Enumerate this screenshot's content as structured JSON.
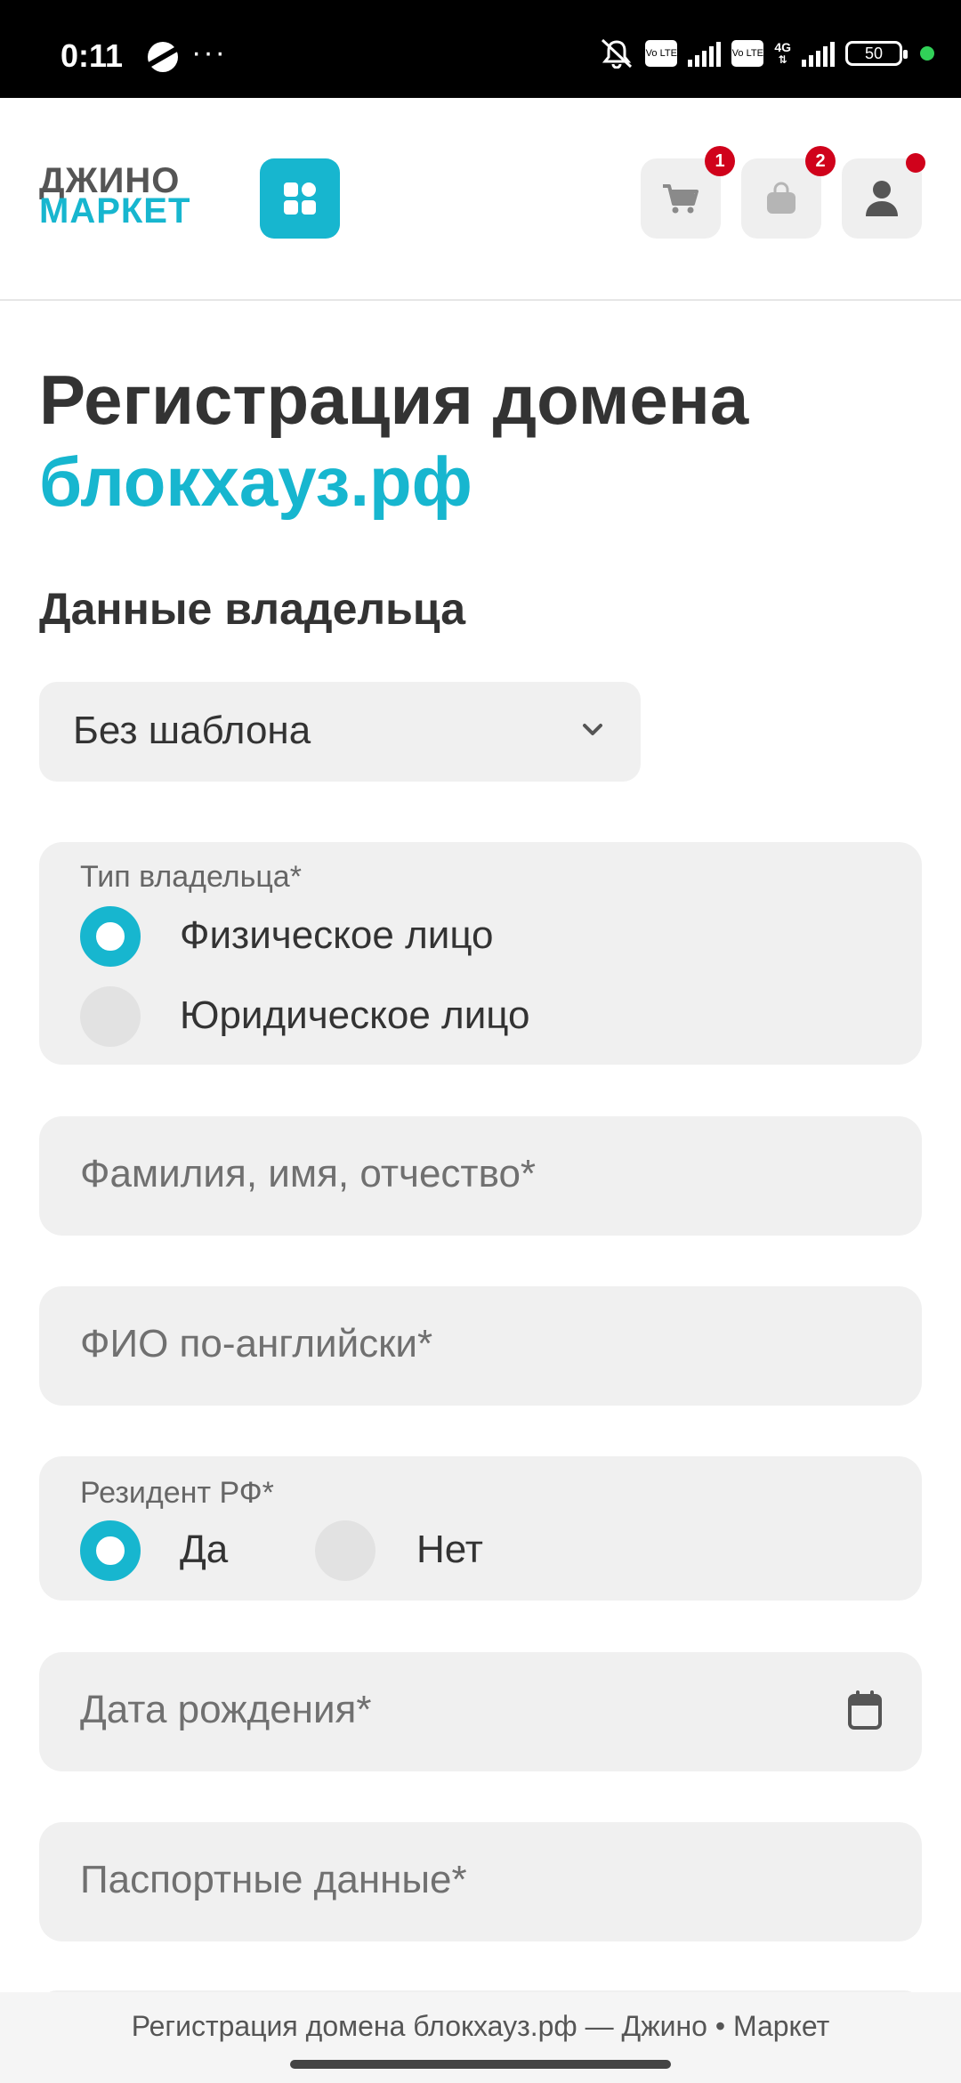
{
  "status_bar": {
    "time": "0:11",
    "dots": "···",
    "lte1": "Vo LTE",
    "lte2": "Vo LTE",
    "net": "4G",
    "battery": "50"
  },
  "header": {
    "logo_line1": "ДЖИНО",
    "logo_line2": "МАРКЕТ",
    "cart_badge": "1",
    "bag_badge": "2",
    "accent_color": "#17b6cf",
    "badge_color": "#d0021b"
  },
  "page": {
    "title": "Регистрация домена",
    "domain": "блокхауз.рф",
    "section_title": "Данные владельца"
  },
  "form": {
    "template_select": {
      "value": "Без шаблона"
    },
    "owner_type": {
      "label": "Тип владельца*",
      "options": [
        {
          "label": "Физическое лицо",
          "selected": true
        },
        {
          "label": "Юридическое лицо",
          "selected": false
        }
      ]
    },
    "full_name": {
      "placeholder": "Фамилия, имя, отчество*"
    },
    "name_en": {
      "placeholder": "ФИО по-английски*"
    },
    "resident": {
      "label": "Резидент РФ*",
      "options": [
        {
          "label": "Да",
          "selected": true
        },
        {
          "label": "Нет",
          "selected": false
        }
      ]
    },
    "birth_date": {
      "placeholder": "Дата рождения*"
    },
    "passport": {
      "placeholder": "Паспортные данные*"
    }
  },
  "footer": {
    "tab_title": "Регистрация домена блокхауз.рф — Джино • Маркет"
  }
}
